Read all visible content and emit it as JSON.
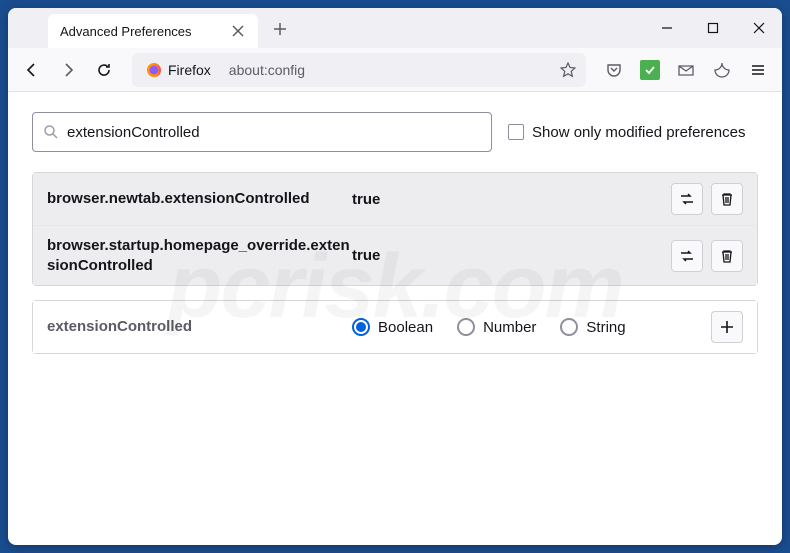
{
  "tab": {
    "title": "Advanced Preferences"
  },
  "urlbar": {
    "label": "Firefox",
    "url": "about:config"
  },
  "search": {
    "value": "extensionControlled",
    "checkbox_label": "Show only modified preferences"
  },
  "prefs": [
    {
      "name": "browser.newtab.extensionControlled",
      "value": "true"
    },
    {
      "name": "browser.startup.homepage_override.extensionControlled",
      "value": "true"
    }
  ],
  "add": {
    "name": "extensionControlled",
    "types": [
      "Boolean",
      "Number",
      "String"
    ],
    "selected": "Boolean"
  },
  "watermark": "pcrisk.com"
}
